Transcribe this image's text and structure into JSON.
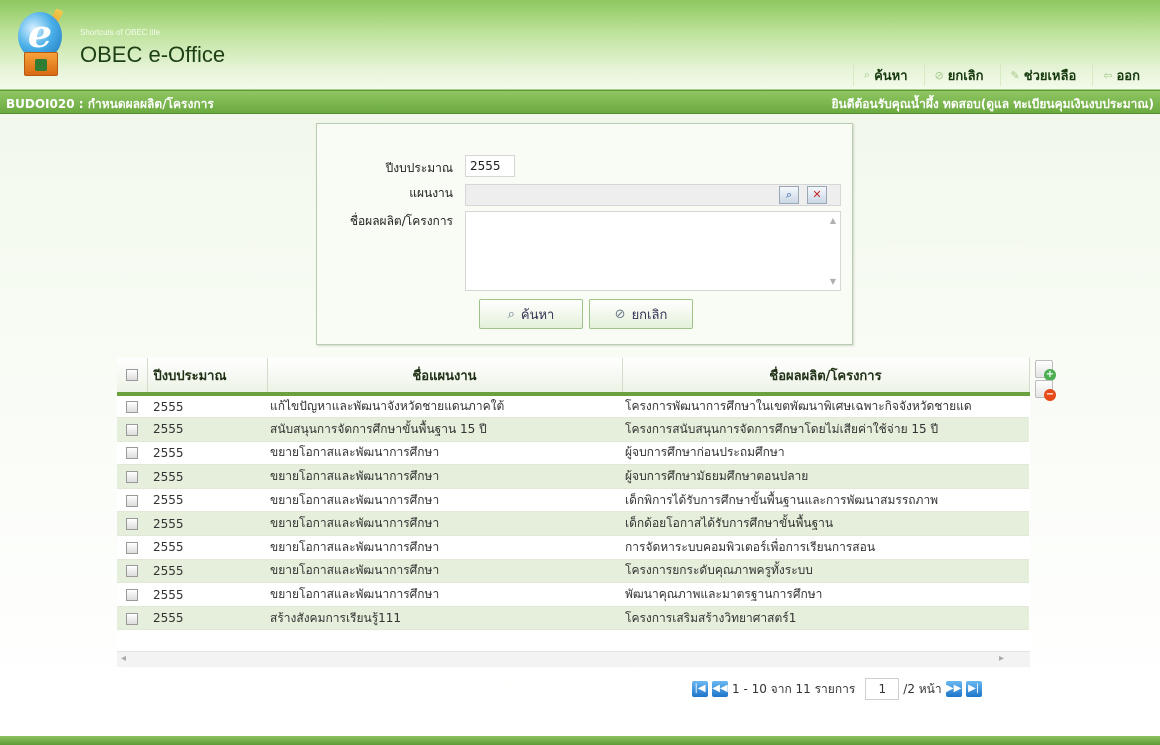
{
  "header": {
    "tagline": "Shortcuts of OBEC life",
    "brand": "OBEC e-Office",
    "menu": [
      {
        "label": "ค้นหา",
        "icon": "search-icon"
      },
      {
        "label": "ยกเลิก",
        "icon": "cancel-icon"
      },
      {
        "label": "ช่วยเหลือ",
        "icon": "help-icon"
      },
      {
        "label": "ออก",
        "icon": "exit-icon"
      }
    ]
  },
  "titlebar": {
    "code": "BUDOI020 : กำหนดผลผลิต/โครงการ",
    "welcome": "ยินดีต้อนรับคุณน้ำผึ้ง ทดสอบ(ดูแล ทะเบียนคุมเงินงบประมาณ)"
  },
  "search_panel": {
    "year_label": "ปีงบประมาณ",
    "year_value": "2555",
    "plan_label": "แผนงาน",
    "plan_value": "",
    "project_label": "ชื่อผลผลิต/โครงการ",
    "project_value": "",
    "search_button": "ค้นหา",
    "cancel_button": "ยกเลิก"
  },
  "table": {
    "columns": [
      "ปีงบประมาณ",
      "ชื่อแผนงาน",
      "ชื่อผลผลิต/โครงการ"
    ],
    "rows": [
      {
        "year": "2555",
        "plan": "แก้ไขปัญหาและพัฒนาจังหวัดชายแดนภาคใต้",
        "project": "โครงการพัฒนาการศึกษาในเขตพัฒนาพิเศษเฉพาะกิจจังหวัดชายแด"
      },
      {
        "year": "2555",
        "plan": "สนับสนุนการจัดการศึกษาขั้นพื้นฐาน 15 ปี",
        "project": "โครงการสนับสนุนการจัดการศึกษาโดยไม่เสียค่าใช้จ่าย 15 ปี"
      },
      {
        "year": "2555",
        "plan": "ขยายโอกาสและพัฒนาการศึกษา",
        "project": "ผู้จบการศึกษาก่อนประถมศึกษา"
      },
      {
        "year": "2555",
        "plan": "ขยายโอกาสและพัฒนาการศึกษา",
        "project": "ผู้จบการศึกษามัธยมศึกษาตอนปลาย"
      },
      {
        "year": "2555",
        "plan": "ขยายโอกาสและพัฒนาการศึกษา",
        "project": "เด็กพิการได้รับการศึกษาขั้นพื้นฐานและการพัฒนาสมรรถภาพ"
      },
      {
        "year": "2555",
        "plan": "ขยายโอกาสและพัฒนาการศึกษา",
        "project": "เด็กด้อยโอกาสได้รับการศึกษาขั้นพื้นฐาน"
      },
      {
        "year": "2555",
        "plan": "ขยายโอกาสและพัฒนาการศึกษา",
        "project": "การจัดหาระบบคอมพิวเตอร์เพื่อการเรียนการสอน"
      },
      {
        "year": "2555",
        "plan": "ขยายโอกาสและพัฒนาการศึกษา",
        "project": "โครงการยกระดับคุณภาพครูทั้งระบบ"
      },
      {
        "year": "2555",
        "plan": "ขยายโอกาสและพัฒนาการศึกษา",
        "project": "พัฒนาคุณภาพและมาตรฐานการศึกษา"
      },
      {
        "year": "2555",
        "plan": "สร้างสังคมการเรียนรู้111",
        "project": "โครงการเสริมสร้างวิทยาศาสตร์1"
      }
    ]
  },
  "pager": {
    "summary": "1 - 10 จาก 11 รายการ",
    "current_page": "1",
    "total_pages": "/2 หน้า"
  },
  "colors": {
    "header_green": "#8ec85f",
    "titlebar_green": "#6caa40",
    "row_alt": "#e6efdb",
    "pager_blue": "#1f76c9"
  }
}
